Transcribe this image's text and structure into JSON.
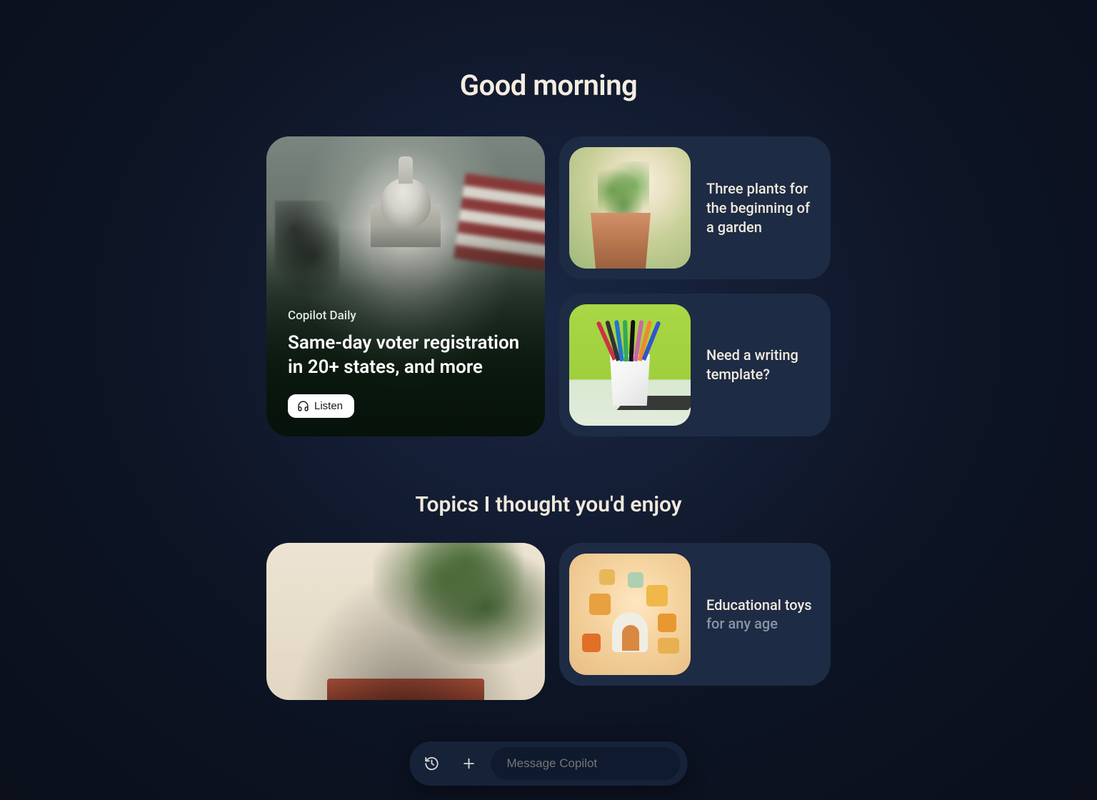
{
  "greeting": "Good morning",
  "hero": {
    "eyebrow": "Copilot Daily",
    "title": "Same-day voter registration in 20+ states, and more",
    "listen_label": "Listen"
  },
  "cards": [
    {
      "title": "Three plants for the beginning of a garden"
    },
    {
      "title": "Need a writing template?"
    }
  ],
  "topics_header": "Topics I thought you'd enjoy",
  "topics": [
    {
      "title": "",
      "sub": ""
    },
    {
      "title": "Educational toys",
      "sub": "for any age"
    }
  ],
  "composer": {
    "placeholder": "Message Copilot"
  },
  "icons": {
    "history": "history-icon",
    "plus": "plus-icon",
    "headphones": "headphones-icon"
  }
}
